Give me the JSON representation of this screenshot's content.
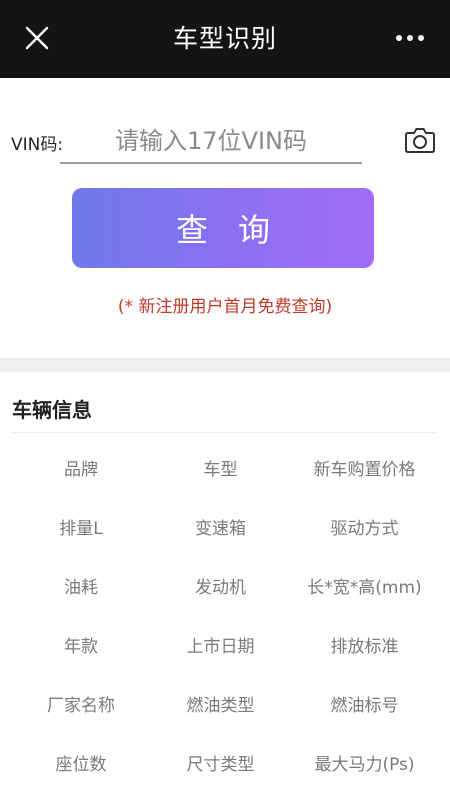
{
  "header": {
    "title": "车型识别",
    "close_icon": "close-icon",
    "more_icon": "more-icon"
  },
  "search": {
    "label": "VIN码:",
    "placeholder": "请输入17位VIN码",
    "value": "",
    "camera_icon": "camera-icon",
    "query_label": "查询",
    "promo_text": "(* 新注册用户首月免费查询)"
  },
  "vehicle_info": {
    "title": "车辆信息",
    "fields": [
      "品牌",
      "车型",
      "新车购置价格",
      "排量L",
      "变速箱",
      "驱动方式",
      "油耗",
      "发动机",
      "长*宽*高(mm)",
      "年款",
      "上市日期",
      "排放标准",
      "厂家名称",
      "燃油类型",
      "燃油标号",
      "座位数",
      "尺寸类型",
      "最大马力(Ps)"
    ]
  },
  "colors": {
    "header_bg": "#141414",
    "button_gradient_start": "#6e79ea",
    "button_gradient_end": "#a06ef6",
    "promo_text": "#c0392b",
    "field_text": "#7a7a7a"
  }
}
